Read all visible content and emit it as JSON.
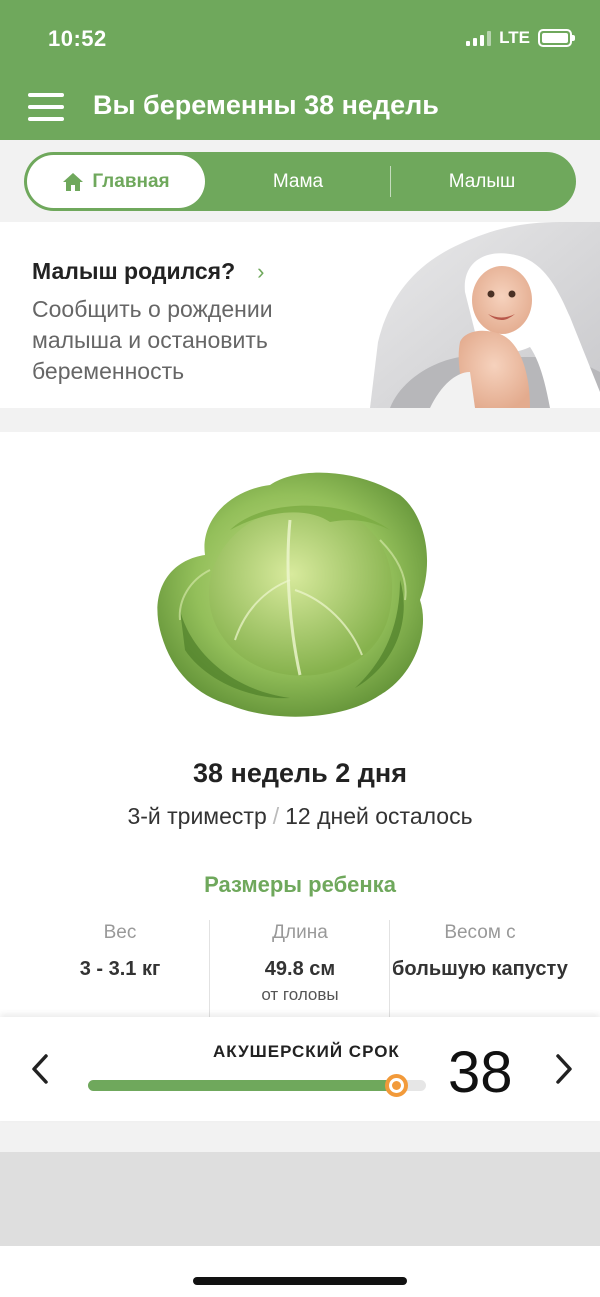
{
  "status_bar": {
    "time": "10:52",
    "network": "LTE",
    "icons": [
      "signal-icon",
      "battery-icon"
    ]
  },
  "app_bar": {
    "title": "Вы беременны 38 недель",
    "menu_icon": "menu-icon"
  },
  "tabs": [
    {
      "label": "Главная",
      "icon": "home-icon",
      "active": true
    },
    {
      "label": "Мама",
      "active": false
    },
    {
      "label": "Малыш",
      "active": false
    }
  ],
  "banner": {
    "title": "Малыш родился?",
    "chevron": "›",
    "text": "Сообщить о рождении малыша и остановить беременность"
  },
  "week_info": {
    "title": "38 недель 2 дня",
    "trimester": "3-й триместр",
    "separator": "/",
    "remaining": "12 дней осталось"
  },
  "sizes": {
    "title": "Размеры ребенка",
    "columns": [
      {
        "label": "Вес",
        "value": "3 - 3.1 кг",
        "note": ""
      },
      {
        "label": "Длина",
        "value": "49.8 см",
        "note": "от головы"
      },
      {
        "label": "Весом с",
        "value": "большую капусту",
        "note": ""
      }
    ]
  },
  "selector": {
    "label": "АКУШЕРСКИЙ СРОК",
    "week": "38",
    "progress_fraction": 0.91
  },
  "colors": {
    "brand_green": "#6fa85c",
    "accent_orange": "#f29a3a",
    "background": "#f2f2f2"
  }
}
